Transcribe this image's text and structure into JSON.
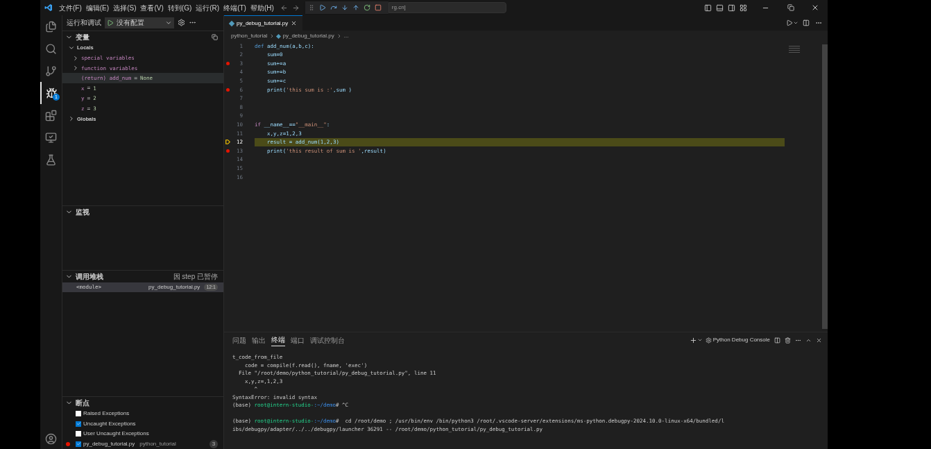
{
  "menu": [
    "文件(F)",
    "编辑(E)",
    "选择(S)",
    "查看(V)",
    "转到(G)",
    "运行(R)",
    "终端(T)",
    "帮助(H)"
  ],
  "search": {
    "value": "rg.cn]"
  },
  "activity": [
    {
      "kind": "files",
      "selected": false
    },
    {
      "kind": "search",
      "selected": false
    },
    {
      "kind": "git",
      "selected": false
    },
    {
      "kind": "debug",
      "selected": true,
      "badge": "1"
    },
    {
      "kind": "extensions",
      "selected": false
    },
    {
      "kind": "remote",
      "selected": false
    },
    {
      "kind": "flask",
      "selected": false
    }
  ],
  "sidebar": {
    "title": "运行和调试",
    "config": "没有配置",
    "variables": {
      "title": "变量",
      "expanded": true,
      "items": [
        {
          "label": "Locals",
          "expanded": true,
          "children": [
            {
              "kind": "group",
              "label": "special variables",
              "expanded": false
            },
            {
              "kind": "group",
              "label": "function variables",
              "expanded": false
            },
            {
              "kind": "var",
              "name": "(return) add_num",
              "sep": "=",
              "value": "None",
              "selected": true
            },
            {
              "kind": "var",
              "name": "x",
              "sep": "=",
              "value": "1",
              "selected": false
            },
            {
              "kind": "var",
              "name": "y",
              "sep": "=",
              "value": "2",
              "selected": false
            },
            {
              "kind": "var",
              "name": "z",
              "sep": "=",
              "value": "3",
              "selected": false
            }
          ]
        },
        {
          "label": "Globals",
          "expanded": false
        }
      ]
    },
    "watch": {
      "title": "监视",
      "expanded": true
    },
    "callstack": {
      "title": "调用堆栈",
      "expanded": true,
      "status": "因 step 已暂停",
      "frames": [
        {
          "name": "<module>",
          "file": "py_debug_tutorial.py",
          "pos": "12:1",
          "selected": true
        }
      ]
    },
    "breakpoints": {
      "title": "断点",
      "expanded": true,
      "items": [
        {
          "kind": "exception",
          "label": "Raised Exceptions",
          "checked": false
        },
        {
          "kind": "exception",
          "label": "Uncaught Exceptions",
          "checked": true
        },
        {
          "kind": "exception",
          "label": "User Uncaught Exceptions",
          "checked": false
        },
        {
          "kind": "file",
          "label": "py_debug_tutorial.py",
          "folder": "python_tutorial",
          "line": "3",
          "checked": true
        }
      ]
    }
  },
  "editor": {
    "tab": "py_debug_tutorial.py",
    "breadcrumb": [
      "python_tutorial",
      "py_debug_tutorial.py",
      "..."
    ],
    "lines": [
      {
        "n": "1",
        "breakpoint": false,
        "current": false,
        "tokens": [
          {
            "t": "def",
            "kind": "keyword"
          },
          {
            "t": "add_num(a,b,c):",
            "kind": "code"
          }
        ]
      },
      {
        "n": "2",
        "breakpoint": false,
        "current": false,
        "tokens": [
          {
            "t": "    sum=0",
            "kind": "code"
          }
        ]
      },
      {
        "n": "3",
        "breakpoint": true,
        "current": false,
        "tokens": [
          {
            "t": "    sum+=a",
            "kind": "code"
          }
        ]
      },
      {
        "n": "4",
        "breakpoint": false,
        "current": false,
        "tokens": [
          {
            "t": "    sum+=b",
            "kind": "code"
          }
        ]
      },
      {
        "n": "5",
        "breakpoint": false,
        "current": false,
        "tokens": [
          {
            "t": "    sum+=c",
            "kind": "code"
          }
        ]
      },
      {
        "n": "6",
        "breakpoint": true,
        "current": false,
        "tokens": [
          {
            "t": "    print(",
            "kind": "code"
          },
          {
            "t": "'this sum is :'",
            "kind": "string"
          },
          {
            "t": ",sum )",
            "kind": "code"
          }
        ]
      },
      {
        "n": "7",
        "breakpoint": false,
        "current": false
      },
      {
        "n": "8",
        "breakpoint": false,
        "current": false
      },
      {
        "n": "9",
        "breakpoint": false,
        "current": false
      },
      {
        "n": "10",
        "breakpoint": false,
        "current": false,
        "tokens": [
          {
            "t": "if",
            "kind": "control"
          },
          {
            "t": "__name__==",
            "kind": "code"
          },
          {
            "t": "\"__main__\"",
            "kind": "string"
          },
          {
            "t": ":",
            "kind": "code"
          }
        ]
      },
      {
        "n": "11",
        "breakpoint": false,
        "current": false,
        "tokens": [
          {
            "t": "    x,y,z=1,2,3",
            "kind": "code"
          }
        ]
      },
      {
        "n": "12",
        "breakpoint": false,
        "current": true,
        "tokens": [
          {
            "t": "    result = add_num(1,2,3)",
            "kind": "code"
          }
        ]
      },
      {
        "n": "13",
        "breakpoint": true,
        "current": false,
        "tokens": [
          {
            "t": "    print(",
            "kind": "code"
          },
          {
            "t": "'this result of sum is '",
            "kind": "string"
          },
          {
            "t": ",result)",
            "kind": "code"
          }
        ]
      },
      {
        "n": "14",
        "breakpoint": false,
        "current": false
      },
      {
        "n": "15",
        "breakpoint": false,
        "current": false
      },
      {
        "n": "16",
        "breakpoint": false,
        "current": false
      }
    ]
  },
  "panel": {
    "tabs": [
      {
        "label": "问题",
        "selected": false
      },
      {
        "label": "输出",
        "selected": false
      },
      {
        "label": "终端",
        "selected": true
      },
      {
        "label": "端口",
        "selected": false
      },
      {
        "label": "调试控制台",
        "selected": false
      }
    ],
    "terminal_name": "Python Debug Console",
    "lines": [
      {
        "space_before": false,
        "segments": [
          {
            "t": "t_code_from_file"
          }
        ]
      },
      {
        "space_before": false,
        "segments": [
          {
            "t": "    code = compile(f.read(), fname, 'exec')"
          }
        ]
      },
      {
        "space_before": false,
        "segments": [
          {
            "t": "  File \"/root/demo/python_tutorial/py_debug_tutorial.py\", line 11"
          }
        ]
      },
      {
        "space_before": false,
        "segments": [
          {
            "t": "    x,y,z=,1,2,3"
          }
        ]
      },
      {
        "space_before": false,
        "segments": [
          {
            "t": "       ^"
          }
        ]
      },
      {
        "space_before": false,
        "segments": [
          {
            "t": "SyntaxError: invalid syntax"
          }
        ]
      },
      {
        "space_before": false,
        "segments": [
          {
            "t": "(base)"
          },
          {
            "t": "root@intern-studio-",
            "kind": "user"
          },
          {
            "t": ":~/demo",
            "kind": "path"
          },
          {
            "t": "# ^C"
          }
        ]
      },
      {
        "space_before": true,
        "segments": [
          {
            "t": "(base)"
          },
          {
            "t": "root@intern-studio-",
            "kind": "user"
          },
          {
            "t": ":~/demo",
            "kind": "path"
          },
          {
            "t": "#  cd /root/demo ; /usr/bin/env /bin/python3 /root/.vscode-server/extensions/ms-python.debugpy-2024.10.0-linux-x64/bundled/l"
          }
        ]
      },
      {
        "space_before": false,
        "segments": [
          {
            "t": "ibs/debugpy/adapter/../../debugpy/launcher 36291 -- /root/demo/python_tutorial/py_debug_tutorial.py"
          }
        ]
      }
    ]
  }
}
